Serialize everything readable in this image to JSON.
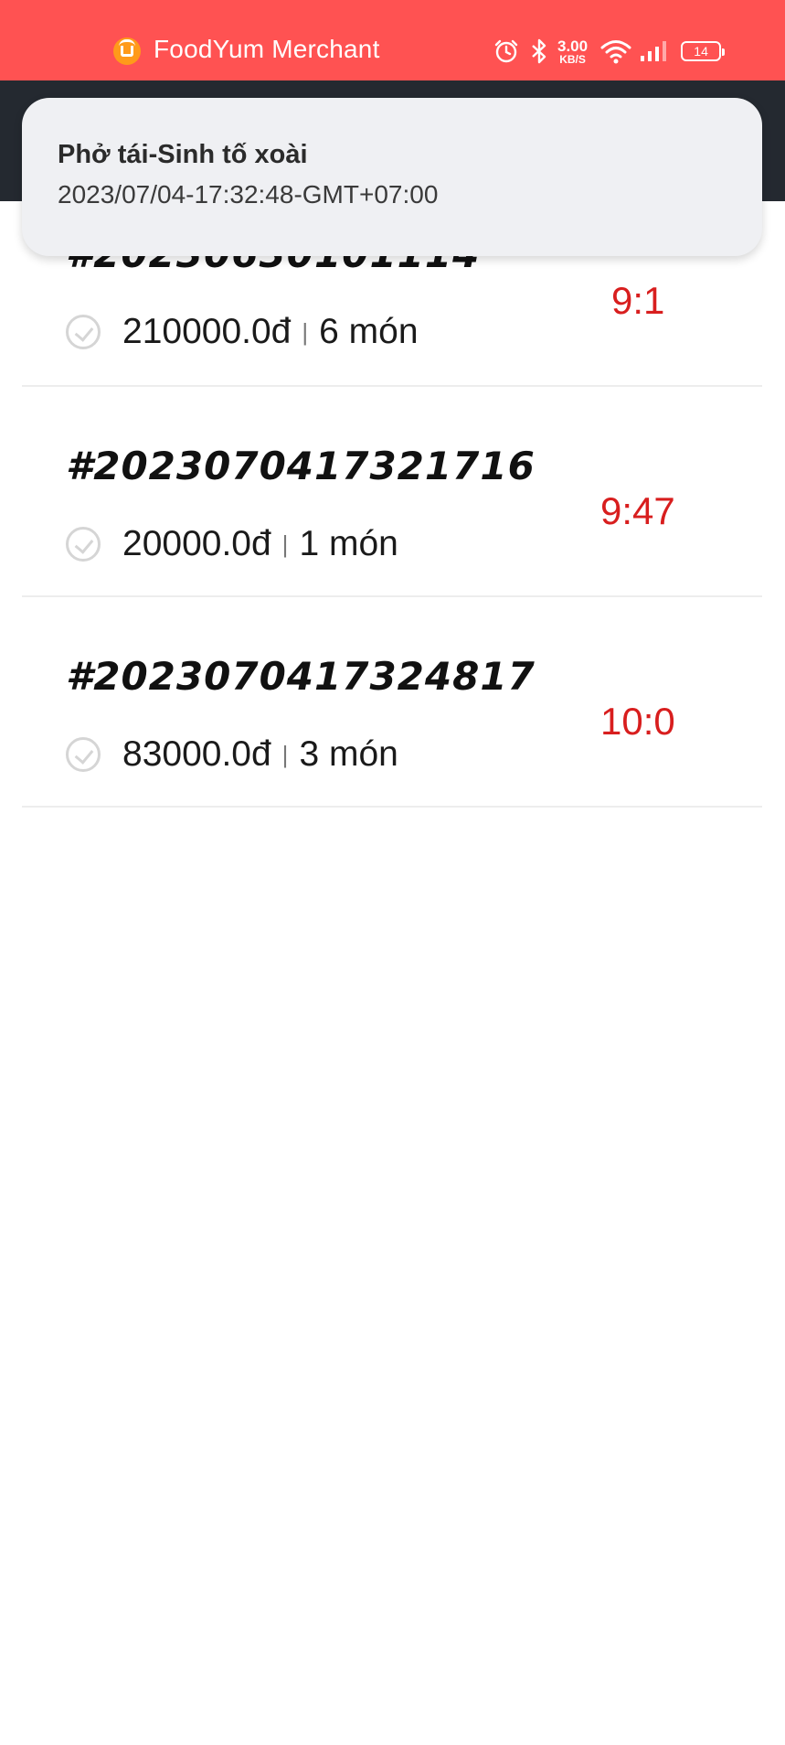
{
  "status_bar": {
    "app_name": "FoodYum Merchant",
    "net_speed_value": "3.00",
    "net_speed_unit": "KB/S",
    "battery": "14",
    "icons": [
      "alarm-icon",
      "bluetooth-icon",
      "wifi-icon",
      "signal-icon",
      "battery-icon"
    ]
  },
  "notification": {
    "title": "Phở tái-Sinh tố xoài",
    "body": "2023/07/04-17:32:48-GMT+07:00"
  },
  "orders": [
    {
      "id": "#20230630101114",
      "price": "210000.0đ",
      "separator": "|",
      "items": "6 món",
      "timer": "9:1"
    },
    {
      "id": "#2023070417321716",
      "price": "20000.0đ",
      "separator": "|",
      "items": "1 món",
      "timer": "9:47"
    },
    {
      "id": "#2023070417324817",
      "price": "83000.0đ",
      "separator": "|",
      "items": "3 món",
      "timer": "10:0"
    }
  ],
  "colors": {
    "status_bar": "#ff5252",
    "toolbar": "#242930",
    "timer": "#d81e1e",
    "notification_bg": "#eff0f3"
  }
}
